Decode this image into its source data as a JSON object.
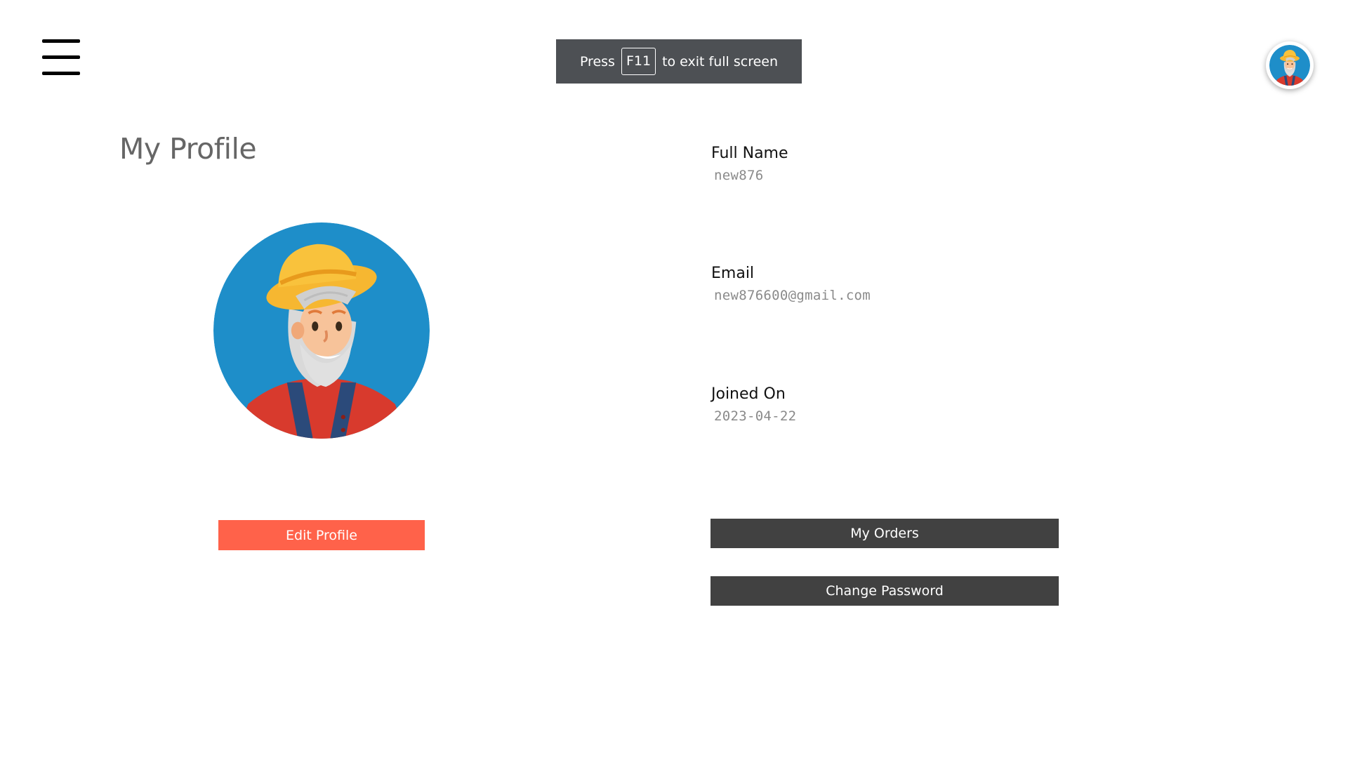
{
  "header": {
    "menu_icon": "hamburger-menu-icon",
    "fullscreen_notice": {
      "prefix": "Press",
      "key": "F11",
      "suffix": "to exit full screen"
    },
    "avatar_icon": "farmer-avatar-icon"
  },
  "profile": {
    "title": "My Profile",
    "avatar_icon": "farmer-avatar-icon",
    "edit_label": "Edit Profile"
  },
  "fields": {
    "full_name": {
      "label": "Full Name",
      "value": "new876"
    },
    "email": {
      "label": "Email",
      "value": "new876600@gmail.com"
    },
    "joined_on": {
      "label": "Joined On",
      "value": "2023-04-22"
    }
  },
  "actions": {
    "orders_label": "My Orders",
    "change_password_label": "Change Password"
  },
  "colors": {
    "edit_button": "#ff624a",
    "dark_button": "#414141",
    "notice_bg": "#4d5054",
    "avatar_bg": "#1e8ec9"
  }
}
